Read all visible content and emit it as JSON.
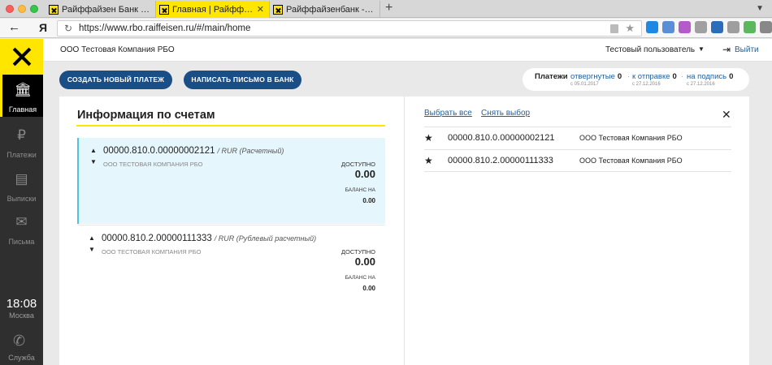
{
  "browser": {
    "tabs": [
      {
        "title": "Райффайзен Банк - Мало",
        "active": false
      },
      {
        "title": "Главная | Райффайзен",
        "active": true
      },
      {
        "title": "Райффайзенбанк - систе",
        "active": false
      }
    ],
    "new_tab": "+",
    "back": "←",
    "ya": "Я",
    "reload": "↻",
    "url": "https://www.rbo.raiffeisen.ru/#/main/home",
    "extension_colors": [
      "#1e88e5",
      "#5b8ed6",
      "#b45acb",
      "#a0a0a0",
      "#2a6ebb",
      "#9e9e9e",
      "#5cb85c",
      "#888888"
    ]
  },
  "header": {
    "company": "ООО Тестовая Компания РБО",
    "user": "Тестовый пользователь",
    "exit": "Выйти"
  },
  "sidebar": {
    "items": [
      {
        "label": "Главная",
        "icon": "bank-icon",
        "glyph": "🏛",
        "active": true
      },
      {
        "label": "Платежи",
        "icon": "payments-icon",
        "glyph": "₽",
        "active": false
      },
      {
        "label": "Выписки",
        "icon": "statements-icon",
        "glyph": "▤",
        "active": false
      },
      {
        "label": "Письма",
        "icon": "mail-icon",
        "glyph": "✉",
        "active": false
      }
    ],
    "time": "18:08",
    "city": "Москва",
    "support_label": "Служба"
  },
  "actions": {
    "new_payment": "СОЗДАТЬ НОВЫЙ ПЛАТЕЖ",
    "write_letter": "НАПИСАТЬ ПИСЬМО В БАНК"
  },
  "payments": {
    "title": "Платежи",
    "items": [
      {
        "label": "отвергнутые",
        "count": "0",
        "date": "с 05.01.2017"
      },
      {
        "label": "к отправке",
        "count": "0",
        "date": "с 27.12.2016"
      },
      {
        "label": "на подпись",
        "count": "0",
        "date": "с 27.12.2016"
      }
    ]
  },
  "accounts": {
    "title": "Информация по счетам",
    "list": [
      {
        "number": "00000.810.0.00000002121",
        "type": "/ RUR (Расчетный)",
        "owner": "ООО ТЕСТОВАЯ КОМПАНИЯ РБО",
        "available_label": "ДОСТУПНО",
        "available": "0.00",
        "balance_label": "БАЛАНС НА",
        "balance": "0.00",
        "selected": true
      },
      {
        "number": "00000.810.2.00000111333",
        "type": "/ RUR (Рублевый расчетный)",
        "owner": "ООО ТЕСТОВАЯ КОМПАНИЯ РБО",
        "available_label": "ДОСТУПНО",
        "available": "0.00",
        "balance_label": "БАЛАНС НА",
        "balance": "0.00",
        "selected": false
      }
    ]
  },
  "favorites": {
    "select_all": "Выбрать все",
    "clear_selection": "Снять выбор",
    "rows": [
      {
        "number": "00000.810.0.00000002121",
        "company": "ООО Тестовая Компания РБО"
      },
      {
        "number": "00000.810.2.00000111333",
        "company": "ООО Тестовая Компания РБО"
      }
    ]
  }
}
